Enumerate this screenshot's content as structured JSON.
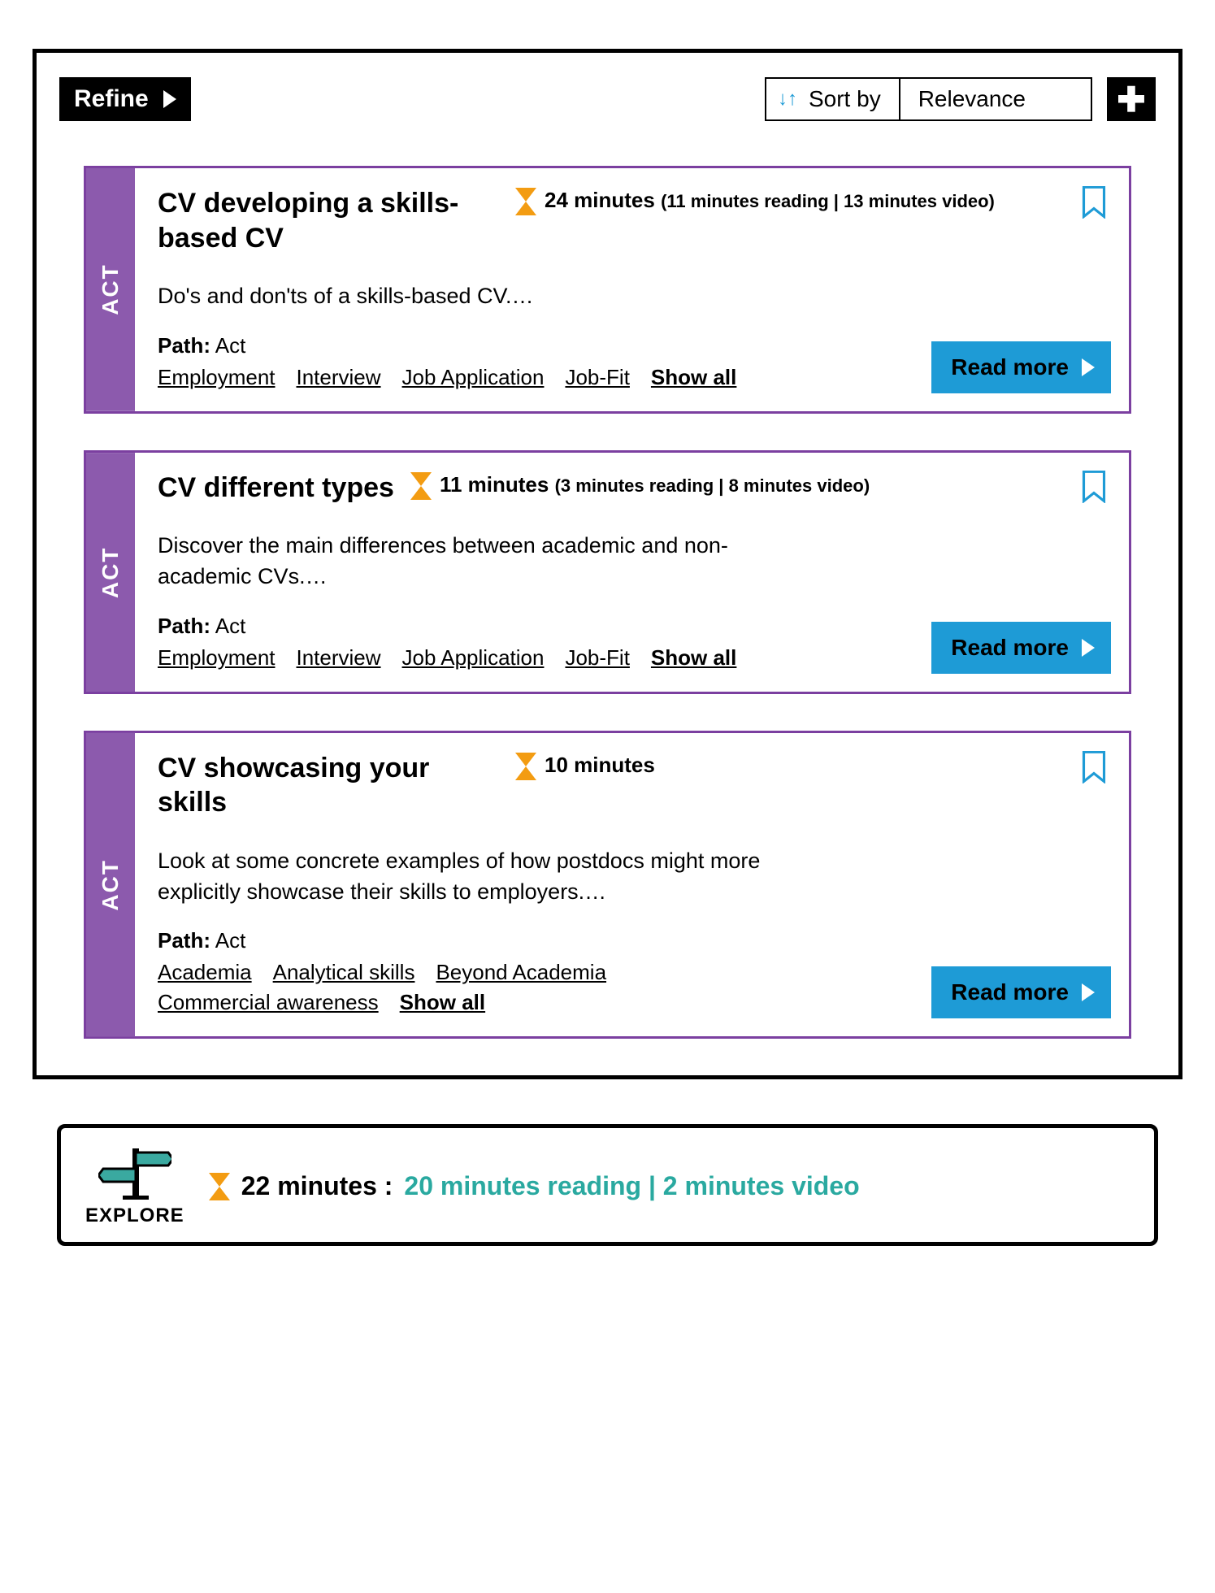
{
  "topbar": {
    "refine_label": "Refine",
    "sort_label": "Sort by",
    "sort_value": "Relevance"
  },
  "cards": [
    {
      "side": "ACT",
      "title": "CV developing a skills-based CV",
      "duration_main": "24 minutes",
      "duration_sub": "(11 minutes reading | 13 minutes video)",
      "desc": "Do's and don'ts of a skills-based CV.…",
      "path_label": "Path:",
      "path_value": "Act",
      "tags": [
        "Employment",
        "Interview",
        "Job Application",
        "Job-Fit"
      ],
      "show_all": "Show all",
      "read_more": "Read more"
    },
    {
      "side": "ACT",
      "title": "CV different types",
      "duration_main": "11 minutes",
      "duration_sub": "(3 minutes reading | 8 minutes video)",
      "desc": "Discover the main differences between academic and non-academic CVs.…",
      "path_label": "Path:",
      "path_value": "Act",
      "tags": [
        "Employment",
        "Interview",
        "Job Application",
        "Job-Fit"
      ],
      "show_all": "Show all",
      "read_more": "Read more"
    },
    {
      "side": "ACT",
      "title": "CV showcasing your skills",
      "duration_main": "10 minutes",
      "duration_sub": "",
      "desc": "Look at some concrete examples of how postdocs might more explicitly showcase their skills to employers.…",
      "path_label": "Path:",
      "path_value": "Act",
      "tags": [
        "Academia",
        "Analytical skills",
        "Beyond Academia",
        "Commercial awareness"
      ],
      "show_all": "Show all",
      "read_more": "Read more"
    }
  ],
  "explore": {
    "label": "EXPLORE",
    "duration_main": "22 minutes :",
    "duration_sub": "20 minutes reading | 2 minutes video"
  }
}
